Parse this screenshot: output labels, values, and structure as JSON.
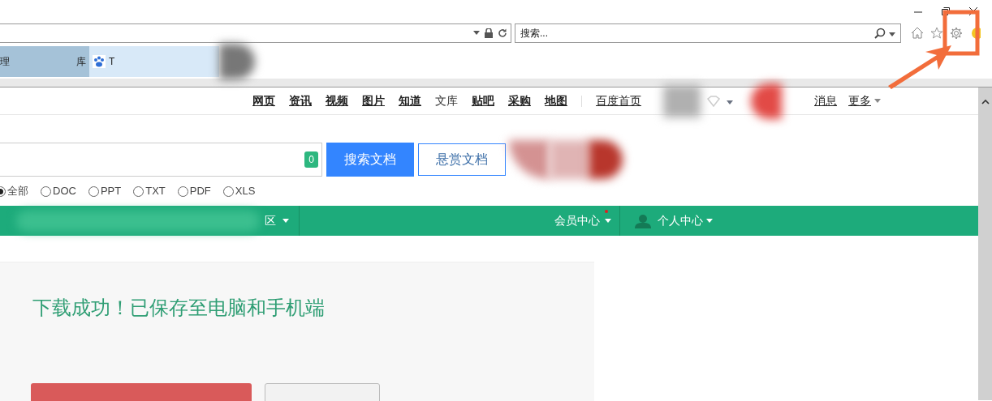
{
  "browser": {
    "search_placeholder": "搜索...",
    "tabs": [
      {
        "label_start": "理",
        "label_end": "库",
        "selected": false
      },
      {
        "label": "T",
        "selected": true
      }
    ]
  },
  "site_nav": {
    "links": [
      {
        "label": "网页",
        "current": false
      },
      {
        "label": "资讯",
        "current": false
      },
      {
        "label": "视频",
        "current": false
      },
      {
        "label": "图片",
        "current": false
      },
      {
        "label": "知道",
        "current": false
      },
      {
        "label": "文库",
        "current": true
      },
      {
        "label": "贴吧",
        "current": false
      },
      {
        "label": "采购",
        "current": false
      },
      {
        "label": "地图",
        "current": false
      }
    ],
    "home_link": "百度首页",
    "messages": "消息",
    "more": "更多"
  },
  "search": {
    "count_badge": "0",
    "search_button": "搜索文档",
    "reward_button": "悬赏文档",
    "filters": [
      {
        "label": "全部",
        "selected": true
      },
      {
        "label": "DOC",
        "selected": false
      },
      {
        "label": "PPT",
        "selected": false
      },
      {
        "label": "TXT",
        "selected": false
      },
      {
        "label": "PDF",
        "selected": false
      },
      {
        "label": "XLS",
        "selected": false
      }
    ]
  },
  "green_bar": {
    "zone_label": "区",
    "member_center": "会员中心",
    "member_badge": true,
    "personal_center": "个人中心"
  },
  "panel": {
    "heading": "下载成功！已保存至电脑和手机端"
  }
}
